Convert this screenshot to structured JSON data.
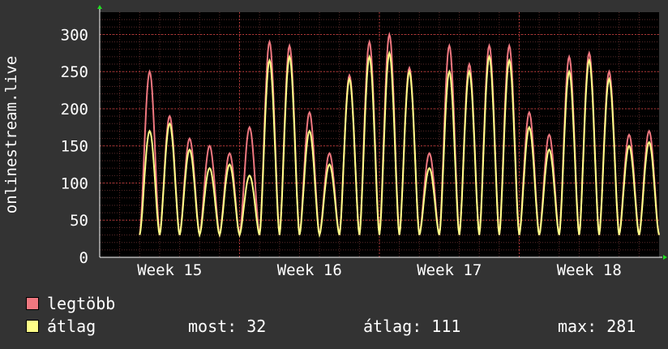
{
  "chart_data": {
    "type": "line",
    "ylabel": "onlinestream.live",
    "yticks": [
      0,
      50,
      100,
      150,
      200,
      250,
      300
    ],
    "ylim": [
      0,
      330
    ],
    "xticks": [
      "Week 15",
      "Week 16",
      "Week 17",
      "Week 18"
    ],
    "x_days": 28,
    "x_tick_days": [
      7,
      14,
      21,
      28
    ],
    "grid": true,
    "legend_position": "bottom-left",
    "series": [
      {
        "name": "legtöbb",
        "color": "#f07880",
        "day_peaks": [
          250,
          190,
          160,
          150,
          140,
          175,
          290,
          285,
          195,
          140,
          245,
          290,
          300,
          255,
          140,
          285,
          260,
          285,
          285,
          195,
          165,
          270,
          275,
          250,
          165,
          170
        ]
      },
      {
        "name": "átlag",
        "color": "#ffff88",
        "day_peaks": [
          170,
          180,
          145,
          120,
          125,
          110,
          265,
          270,
          170,
          125,
          240,
          270,
          275,
          250,
          120,
          250,
          250,
          270,
          265,
          175,
          145,
          250,
          265,
          240,
          150,
          155
        ]
      }
    ],
    "day_min": 30
  },
  "legend": {
    "items": [
      {
        "label": "legtöbb",
        "color": "#f07880"
      },
      {
        "label": "átlag",
        "color": "#ffff88"
      }
    ],
    "stats": {
      "most": "most: 32",
      "atlag": "átlag: 111",
      "max": "max: 281"
    }
  },
  "colors": {
    "background": "#333333",
    "plot_background": "#000000",
    "grid": "#d04040",
    "text": "#ffffff"
  }
}
